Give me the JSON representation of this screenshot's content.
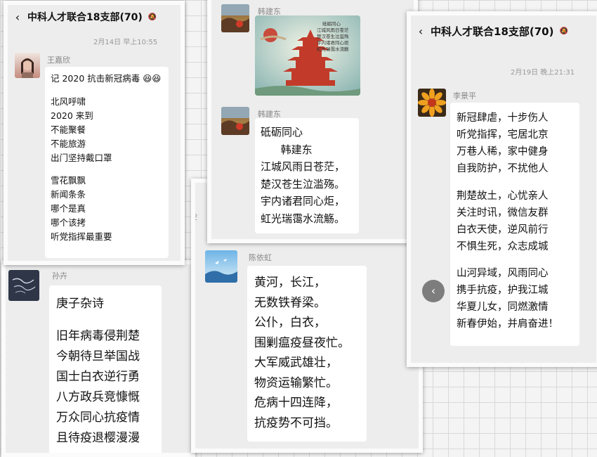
{
  "palette": {
    "bubble": "#ffffff",
    "chat_bg": "#ededed",
    "name_gray": "#888888",
    "nav_button": "#7d7d7d"
  },
  "icons": {
    "back": "chevron-left-icon",
    "mute": "bell-off-icon",
    "next": "chevron-left-icon"
  },
  "left_top": {
    "title": "中科人才联合18支部(70)",
    "time": "2月14日 早上10:55",
    "sender": "王嘉欣",
    "lines": [
      "记 2020 抗击新冠病毒 😆😆",
      "",
      "北风呼啸",
      "2020 来到",
      "不能聚餐",
      "不能旅游",
      "出门坚持戴口罩",
      "",
      "雪花飘飘",
      "新闻条条",
      "哪个是真",
      "哪个该拷",
      "听党指挥最重要"
    ]
  },
  "left_bottom": {
    "sender": "孙卉",
    "lines": [
      "庚子杂诗",
      "",
      "旧年病毒侵荆楚",
      "今朝待旦举国战",
      "国士白衣逆行勇",
      "八方政兵竞慷慨",
      "万众同心抗疫情",
      "且待疫退樱漫漫"
    ]
  },
  "middle_top": {
    "sender_image": "韩建东",
    "image_text": [
      "砥砺同心",
      "江城风雨日苍茫",
      "楚汉苍生泣滥殇",
      "宇内诸君同心炬",
      "虹光瑞霭水流觞"
    ],
    "sender_text": "韩建东",
    "lines": [
      "砥砺同心",
      "      韩建东",
      "江城风雨日苍茫，",
      "楚汉苍生泣滥殇。",
      "宇内诸君同心炬，",
      "虹光瑞霭水流觞。"
    ]
  },
  "middle_bottom": {
    "sender": "陈依虹",
    "lines": [
      "黄河，长江，",
      "无数铁脊梁。",
      "公仆，白衣，",
      "围剿瘟疫昼夜忙。",
      "大军威武雄壮，",
      "物资运输繁忙。",
      "危病十四连降，",
      "抗疫势不可挡。"
    ]
  },
  "right": {
    "title": "中科人才联合18支部(70)",
    "time": "2月19日 晚上21:31",
    "sender": "李景平",
    "lines": [
      "新冠肆虐，十步伤人",
      "听党指挥，宅居北京",
      "万巷人稀，家中健身",
      "自我防护，不扰他人",
      "",
      "荆楚故土，心忧亲人",
      "关注时讯，微信友群",
      "白衣天使，逆风前行",
      "不惧生死，众志成城",
      "",
      "山河异域，风雨同心",
      "携手抗疫，护我江城",
      "华夏儿女，同燃激情",
      "新春伊始，并肩奋进！"
    ]
  },
  "fragments": {
    "left_edge_1": "2",
    "left_edge_2": ":0"
  }
}
